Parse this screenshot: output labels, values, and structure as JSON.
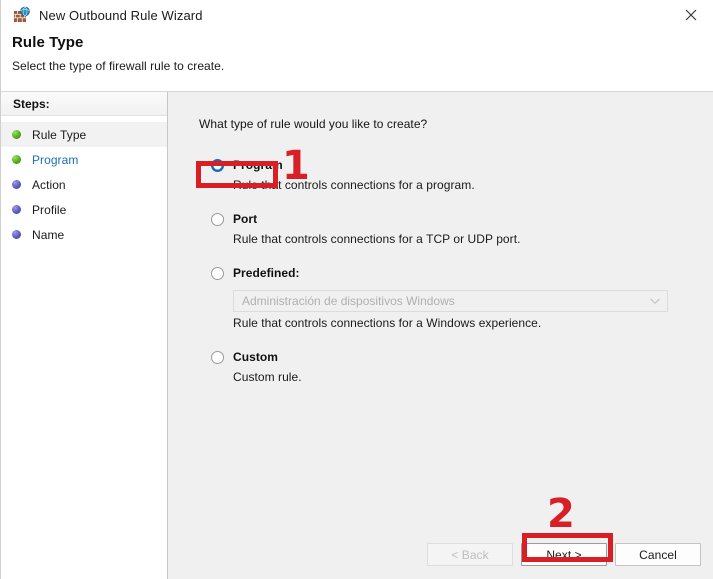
{
  "window": {
    "title": "New Outbound Rule Wizard",
    "icon": "firewall-globe-icon",
    "close_label": "×"
  },
  "header": {
    "title": "Rule Type",
    "subtitle": "Select the type of firewall rule to create."
  },
  "sidebar": {
    "heading": "Steps:",
    "items": [
      {
        "label": "Rule Type",
        "dot": "green",
        "state": "current"
      },
      {
        "label": "Program",
        "dot": "green",
        "state": "link"
      },
      {
        "label": "Action",
        "dot": "blue",
        "state": "pending"
      },
      {
        "label": "Profile",
        "dot": "blue",
        "state": "pending"
      },
      {
        "label": "Name",
        "dot": "blue",
        "state": "pending"
      }
    ]
  },
  "main": {
    "question": "What type of rule would you like to create?",
    "options": [
      {
        "label": "Program",
        "description": "Rule that controls connections for a program.",
        "selected": true
      },
      {
        "label": "Port",
        "description": "Rule that controls connections for a TCP or UDP port.",
        "selected": false
      },
      {
        "label": "Predefined:",
        "description": "Rule that controls connections for a Windows experience.",
        "selected": false
      },
      {
        "label": "Custom",
        "description": "Custom rule.",
        "selected": false
      }
    ],
    "predefined_combo": {
      "value": "Administración de dispositivos Windows",
      "enabled": false,
      "chevron": "chevron-down-icon"
    }
  },
  "footer": {
    "back_label": "< Back",
    "next_label": "Next >",
    "cancel_label": "Cancel"
  },
  "annotations": {
    "color": "#d81f26",
    "marker_1": "1",
    "marker_2": "2"
  }
}
